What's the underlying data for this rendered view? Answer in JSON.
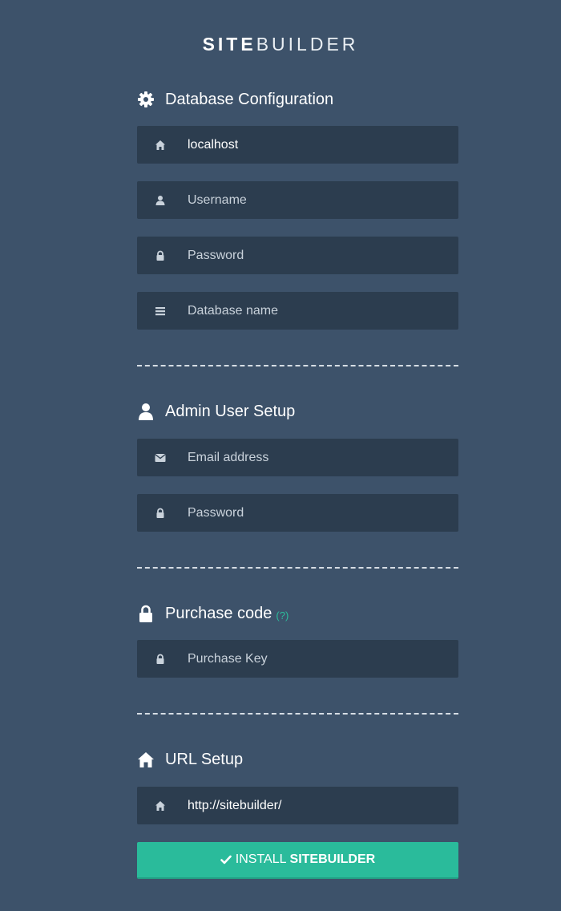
{
  "logo": {
    "bold": "SITE",
    "light": "BUILDER"
  },
  "database": {
    "title": "Database Configuration",
    "title_icon": "gear-icon",
    "fields": [
      {
        "icon": "home-icon",
        "value": "localhost",
        "placeholder": ""
      },
      {
        "icon": "user-icon",
        "value": "",
        "placeholder": "Username"
      },
      {
        "icon": "lock-icon",
        "value": "",
        "placeholder": "Password"
      },
      {
        "icon": "database-icon",
        "value": "",
        "placeholder": "Database name"
      }
    ]
  },
  "admin": {
    "title": "Admin User Setup",
    "title_icon": "user-icon",
    "fields": [
      {
        "icon": "envelope-icon",
        "value": "",
        "placeholder": "Email address"
      },
      {
        "icon": "lock-icon",
        "value": "",
        "placeholder": "Password"
      }
    ]
  },
  "purchase": {
    "title": "Purchase code",
    "help": "(?)",
    "title_icon": "lock-icon",
    "fields": [
      {
        "icon": "lock-icon",
        "value": "",
        "placeholder": "Purchase Key"
      }
    ]
  },
  "url": {
    "title": "URL Setup",
    "title_icon": "home-icon",
    "fields": [
      {
        "icon": "home-icon",
        "value": "http://sitebuilder/",
        "placeholder": ""
      }
    ]
  },
  "install_button": {
    "prefix": "INSTALL",
    "bold": "SITEBUILDER",
    "icon": "check-icon"
  },
  "colors": {
    "background": "#3d526a",
    "field_background": "#2c3d4f",
    "accent": "#2abb9b"
  }
}
